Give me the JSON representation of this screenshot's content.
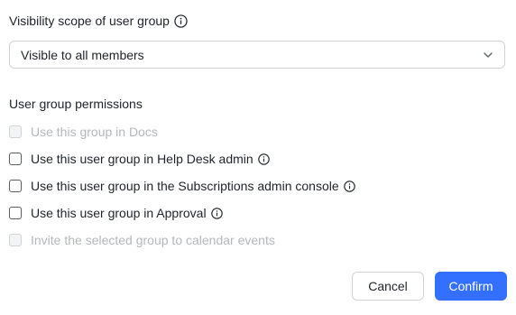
{
  "visibility": {
    "label": "Visibility scope of user group",
    "selected": "Visible to all members"
  },
  "permissions": {
    "label": "User group permissions",
    "items": [
      {
        "label": "Use this group in Docs",
        "checked": false,
        "disabled": true,
        "info": false
      },
      {
        "label": "Use this user group in Help Desk admin",
        "checked": false,
        "disabled": false,
        "info": true
      },
      {
        "label": "Use this user group in the Subscriptions admin console",
        "checked": false,
        "disabled": false,
        "info": true
      },
      {
        "label": "Use this user group in Approval",
        "checked": false,
        "disabled": false,
        "info": true
      },
      {
        "label": "Invite the selected group to calendar events",
        "checked": false,
        "disabled": true,
        "info": false
      }
    ]
  },
  "buttons": {
    "cancel": "Cancel",
    "confirm": "Confirm"
  },
  "colors": {
    "accent": "#3370ff",
    "text": "#1f2329",
    "disabled_text": "#b4b7bb",
    "border": "#d0d3d6"
  }
}
